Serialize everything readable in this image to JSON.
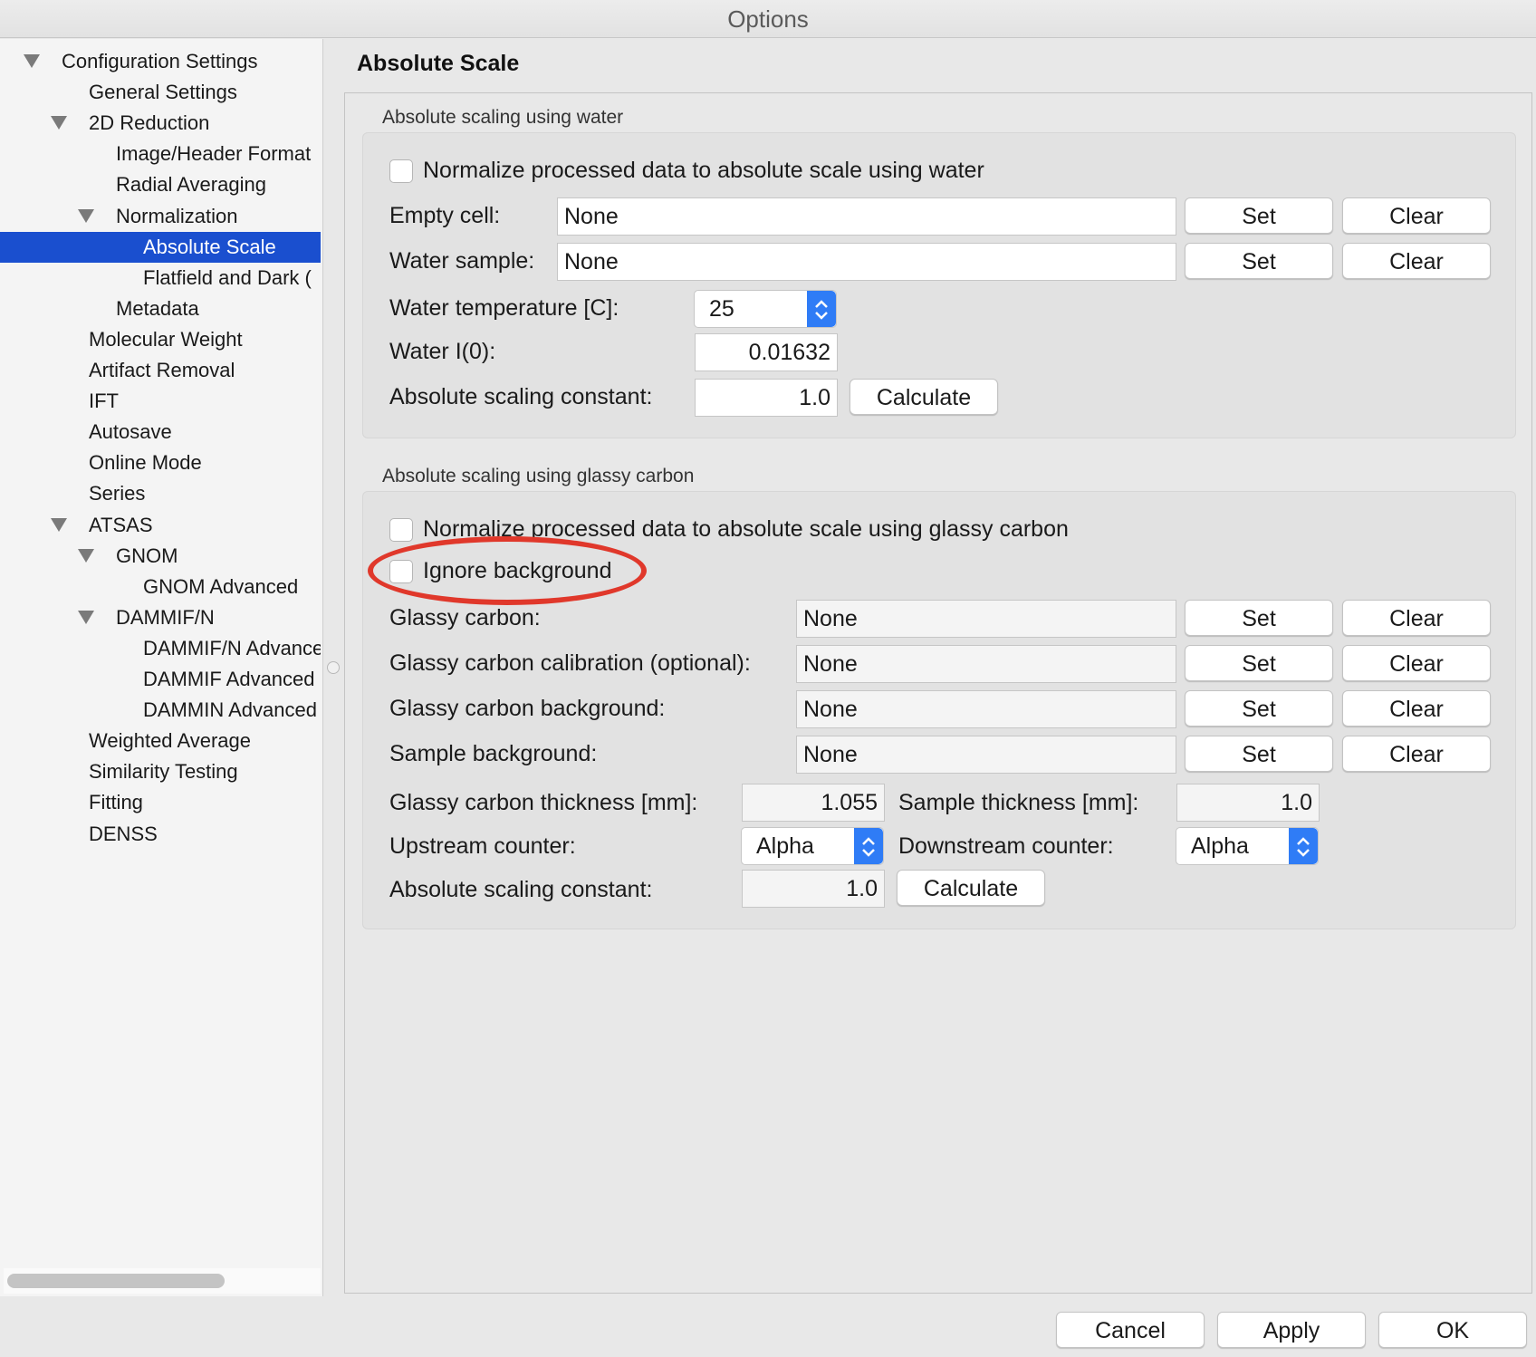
{
  "window": {
    "title": "Options"
  },
  "sidebar": {
    "items": [
      {
        "label": "Configuration Settings",
        "level": 0,
        "expanded": true,
        "selected": false
      },
      {
        "label": "General Settings",
        "level": 1,
        "expanded": null,
        "selected": false
      },
      {
        "label": "2D Reduction",
        "level": 1,
        "expanded": true,
        "selected": false
      },
      {
        "label": "Image/Header Format",
        "level": 2,
        "expanded": null,
        "selected": false
      },
      {
        "label": "Radial Averaging",
        "level": 2,
        "expanded": null,
        "selected": false
      },
      {
        "label": "Normalization",
        "level": 2,
        "expanded": true,
        "selected": false
      },
      {
        "label": "Absolute Scale",
        "level": 3,
        "expanded": null,
        "selected": true
      },
      {
        "label": "Flatfield and Dark (",
        "level": 3,
        "expanded": null,
        "selected": false
      },
      {
        "label": "Metadata",
        "level": 2,
        "expanded": null,
        "selected": false
      },
      {
        "label": "Molecular Weight",
        "level": 1,
        "expanded": null,
        "selected": false
      },
      {
        "label": "Artifact Removal",
        "level": 1,
        "expanded": null,
        "selected": false
      },
      {
        "label": "IFT",
        "level": 1,
        "expanded": null,
        "selected": false
      },
      {
        "label": "Autosave",
        "level": 1,
        "expanded": null,
        "selected": false
      },
      {
        "label": "Online Mode",
        "level": 1,
        "expanded": null,
        "selected": false
      },
      {
        "label": "Series",
        "level": 1,
        "expanded": null,
        "selected": false
      },
      {
        "label": "ATSAS",
        "level": 1,
        "expanded": true,
        "selected": false
      },
      {
        "label": "GNOM",
        "level": 2,
        "expanded": true,
        "selected": false
      },
      {
        "label": "GNOM Advanced",
        "level": 3,
        "expanded": null,
        "selected": false
      },
      {
        "label": "DAMMIF/N",
        "level": 2,
        "expanded": true,
        "selected": false
      },
      {
        "label": "DAMMIF/N Advance",
        "level": 3,
        "expanded": null,
        "selected": false
      },
      {
        "label": "DAMMIF Advanced",
        "level": 3,
        "expanded": null,
        "selected": false
      },
      {
        "label": "DAMMIN Advanced",
        "level": 3,
        "expanded": null,
        "selected": false
      },
      {
        "label": "Weighted Average",
        "level": 1,
        "expanded": null,
        "selected": false
      },
      {
        "label": "Similarity Testing",
        "level": 1,
        "expanded": null,
        "selected": false
      },
      {
        "label": "Fitting",
        "level": 1,
        "expanded": null,
        "selected": false
      },
      {
        "label": "DENSS",
        "level": 1,
        "expanded": null,
        "selected": false
      }
    ]
  },
  "page": {
    "title": "Absolute Scale"
  },
  "water": {
    "group_label": "Absolute scaling using water",
    "normalize_label": "Normalize processed data to absolute scale using water",
    "normalize_checked": false,
    "empty_cell": {
      "label": "Empty cell:",
      "value": "None",
      "set": "Set",
      "clear": "Clear"
    },
    "water_sample": {
      "label": "Water sample:",
      "value": "None",
      "set": "Set",
      "clear": "Clear"
    },
    "temperature": {
      "label": "Water temperature [C]:",
      "value": "25"
    },
    "i0": {
      "label": "Water I(0):",
      "value": "0.01632"
    },
    "constant": {
      "label": "Absolute scaling constant:",
      "value": "1.0",
      "calculate": "Calculate"
    }
  },
  "glassy": {
    "group_label": "Absolute scaling using glassy carbon",
    "normalize_label": "Normalize processed data to absolute scale using glassy carbon",
    "normalize_checked": false,
    "ignore_label": "Ignore background",
    "ignore_checked": false,
    "glassy_carbon": {
      "label": "Glassy carbon:",
      "value": "None",
      "set": "Set",
      "clear": "Clear"
    },
    "calibration": {
      "label": "Glassy carbon calibration (optional):",
      "value": "None",
      "set": "Set",
      "clear": "Clear"
    },
    "gc_background": {
      "label": "Glassy carbon background:",
      "value": "None",
      "set": "Set",
      "clear": "Clear"
    },
    "sample_background": {
      "label": "Sample background:",
      "value": "None",
      "set": "Set",
      "clear": "Clear"
    },
    "gc_thickness": {
      "label": "Glassy carbon thickness [mm]:",
      "value": "1.055"
    },
    "sample_thickness": {
      "label": "Sample thickness [mm]:",
      "value": "1.0"
    },
    "upstream": {
      "label": "Upstream counter:",
      "value": "Alpha"
    },
    "downstream": {
      "label": "Downstream counter:",
      "value": "Alpha"
    },
    "constant": {
      "label": "Absolute scaling constant:",
      "value": "1.0",
      "calculate": "Calculate"
    }
  },
  "footer": {
    "cancel": "Cancel",
    "apply": "Apply",
    "ok": "OK"
  },
  "colors": {
    "selection": "#1a4fcf",
    "annotation": "#e0382b",
    "spin_accent": "#2f7cf6"
  },
  "icons": {
    "tree_expanded": "disclosure-triangle-icon",
    "spinner": "up-down-chevron-icon"
  }
}
